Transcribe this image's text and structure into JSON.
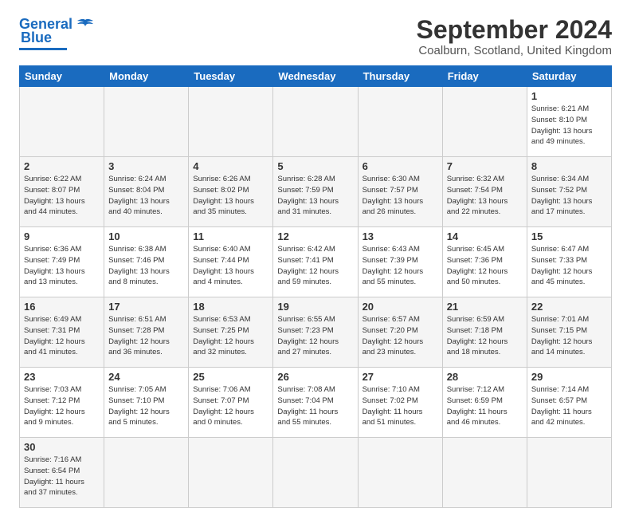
{
  "logo": {
    "line1": "General",
    "line2": "Blue"
  },
  "title": "September 2024",
  "subtitle": "Coalburn, Scotland, United Kingdom",
  "weekdays": [
    "Sunday",
    "Monday",
    "Tuesday",
    "Wednesday",
    "Thursday",
    "Friday",
    "Saturday"
  ],
  "days": [
    {
      "num": "",
      "info": ""
    },
    {
      "num": "",
      "info": ""
    },
    {
      "num": "",
      "info": ""
    },
    {
      "num": "",
      "info": ""
    },
    {
      "num": "",
      "info": ""
    },
    {
      "num": "",
      "info": ""
    },
    {
      "num": "1",
      "info": "Sunrise: 6:21 AM\nSunset: 8:10 PM\nDaylight: 13 hours\nand 49 minutes."
    },
    {
      "num": "2",
      "info": "Sunrise: 6:22 AM\nSunset: 8:07 PM\nDaylight: 13 hours\nand 44 minutes."
    },
    {
      "num": "3",
      "info": "Sunrise: 6:24 AM\nSunset: 8:04 PM\nDaylight: 13 hours\nand 40 minutes."
    },
    {
      "num": "4",
      "info": "Sunrise: 6:26 AM\nSunset: 8:02 PM\nDaylight: 13 hours\nand 35 minutes."
    },
    {
      "num": "5",
      "info": "Sunrise: 6:28 AM\nSunset: 7:59 PM\nDaylight: 13 hours\nand 31 minutes."
    },
    {
      "num": "6",
      "info": "Sunrise: 6:30 AM\nSunset: 7:57 PM\nDaylight: 13 hours\nand 26 minutes."
    },
    {
      "num": "7",
      "info": "Sunrise: 6:32 AM\nSunset: 7:54 PM\nDaylight: 13 hours\nand 22 minutes."
    },
    {
      "num": "8",
      "info": "Sunrise: 6:34 AM\nSunset: 7:52 PM\nDaylight: 13 hours\nand 17 minutes."
    },
    {
      "num": "9",
      "info": "Sunrise: 6:36 AM\nSunset: 7:49 PM\nDaylight: 13 hours\nand 13 minutes."
    },
    {
      "num": "10",
      "info": "Sunrise: 6:38 AM\nSunset: 7:46 PM\nDaylight: 13 hours\nand 8 minutes."
    },
    {
      "num": "11",
      "info": "Sunrise: 6:40 AM\nSunset: 7:44 PM\nDaylight: 13 hours\nand 4 minutes."
    },
    {
      "num": "12",
      "info": "Sunrise: 6:42 AM\nSunset: 7:41 PM\nDaylight: 12 hours\nand 59 minutes."
    },
    {
      "num": "13",
      "info": "Sunrise: 6:43 AM\nSunset: 7:39 PM\nDaylight: 12 hours\nand 55 minutes."
    },
    {
      "num": "14",
      "info": "Sunrise: 6:45 AM\nSunset: 7:36 PM\nDaylight: 12 hours\nand 50 minutes."
    },
    {
      "num": "15",
      "info": "Sunrise: 6:47 AM\nSunset: 7:33 PM\nDaylight: 12 hours\nand 45 minutes."
    },
    {
      "num": "16",
      "info": "Sunrise: 6:49 AM\nSunset: 7:31 PM\nDaylight: 12 hours\nand 41 minutes."
    },
    {
      "num": "17",
      "info": "Sunrise: 6:51 AM\nSunset: 7:28 PM\nDaylight: 12 hours\nand 36 minutes."
    },
    {
      "num": "18",
      "info": "Sunrise: 6:53 AM\nSunset: 7:25 PM\nDaylight: 12 hours\nand 32 minutes."
    },
    {
      "num": "19",
      "info": "Sunrise: 6:55 AM\nSunset: 7:23 PM\nDaylight: 12 hours\nand 27 minutes."
    },
    {
      "num": "20",
      "info": "Sunrise: 6:57 AM\nSunset: 7:20 PM\nDaylight: 12 hours\nand 23 minutes."
    },
    {
      "num": "21",
      "info": "Sunrise: 6:59 AM\nSunset: 7:18 PM\nDaylight: 12 hours\nand 18 minutes."
    },
    {
      "num": "22",
      "info": "Sunrise: 7:01 AM\nSunset: 7:15 PM\nDaylight: 12 hours\nand 14 minutes."
    },
    {
      "num": "23",
      "info": "Sunrise: 7:03 AM\nSunset: 7:12 PM\nDaylight: 12 hours\nand 9 minutes."
    },
    {
      "num": "24",
      "info": "Sunrise: 7:05 AM\nSunset: 7:10 PM\nDaylight: 12 hours\nand 5 minutes."
    },
    {
      "num": "25",
      "info": "Sunrise: 7:06 AM\nSunset: 7:07 PM\nDaylight: 12 hours\nand 0 minutes."
    },
    {
      "num": "26",
      "info": "Sunrise: 7:08 AM\nSunset: 7:04 PM\nDaylight: 11 hours\nand 55 minutes."
    },
    {
      "num": "27",
      "info": "Sunrise: 7:10 AM\nSunset: 7:02 PM\nDaylight: 11 hours\nand 51 minutes."
    },
    {
      "num": "28",
      "info": "Sunrise: 7:12 AM\nSunset: 6:59 PM\nDaylight: 11 hours\nand 46 minutes."
    },
    {
      "num": "29",
      "info": "Sunrise: 7:14 AM\nSunset: 6:57 PM\nDaylight: 11 hours\nand 42 minutes."
    },
    {
      "num": "30",
      "info": "Sunrise: 7:16 AM\nSunset: 6:54 PM\nDaylight: 11 hours\nand 37 minutes."
    },
    {
      "num": "",
      "info": ""
    },
    {
      "num": "",
      "info": ""
    },
    {
      "num": "",
      "info": ""
    },
    {
      "num": "",
      "info": ""
    },
    {
      "num": "",
      "info": ""
    }
  ]
}
